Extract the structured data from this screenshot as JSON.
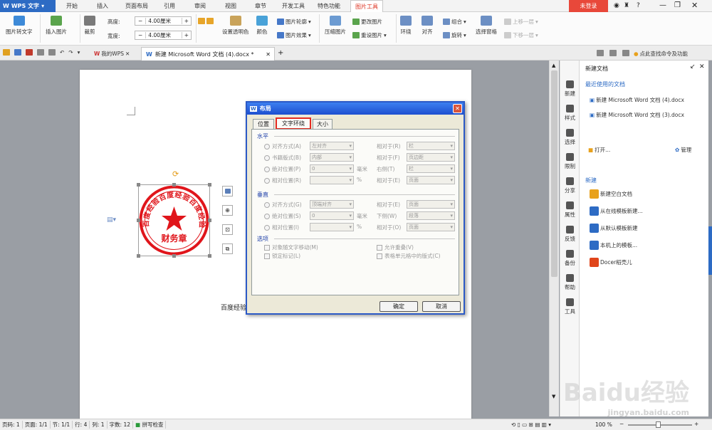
{
  "app": {
    "name": "WPS 文字",
    "login": "未登录",
    "help": "?"
  },
  "tabs": [
    "开始",
    "插入",
    "页面布局",
    "引用",
    "审阅",
    "视图",
    "章节",
    "开发工具",
    "特色功能",
    "图片工具"
  ],
  "ribbon": {
    "pic_to_text": "图片转文字",
    "insert_pic": "插入图片",
    "crop": "裁剪",
    "height_label": "高度:",
    "height_value": "4.00厘米",
    "width_label": "宽度:",
    "width_value": "4.00厘米",
    "set_transparent": "设置透明色",
    "color": "颜色",
    "outline": "图片轮廓",
    "effect": "图片效果",
    "compress": "压缩图片",
    "change_pic": "更改图片",
    "reset_pic": "重设图片",
    "wrap": "环绕",
    "align": "对齐",
    "group": "组合",
    "rotate": "旋转",
    "select_pane": "选择窗格",
    "bring_forward": "上移一层",
    "send_backward": "下移一层"
  },
  "quickaccess": {
    "my_wps": "我的WPS",
    "doc_tab": "新建 Microsoft Word 文档 (4).docx *",
    "search_hint": "点此查找命令及功能"
  },
  "seal": {
    "ring_text": "百度经验百度经验百度经验",
    "center_text": "财务章"
  },
  "page_text": "百度经验",
  "dialog": {
    "title": "布局",
    "tabs": [
      "位置",
      "文字环绕",
      "大小"
    ],
    "active_tab": "文字环绕",
    "horizontal": "水平",
    "vertical": "垂直",
    "options": "选项",
    "h_rows": [
      {
        "label": "对齐方式(A)",
        "value": "左对齐",
        "rel": "相对于(R)",
        "relv": "栏"
      },
      {
        "label": "书籍版式(B)",
        "value": "内部",
        "rel": "相对于(F)",
        "relv": "页边距"
      },
      {
        "label": "绝对位置(P)",
        "value": "0",
        "unit": "毫米",
        "rel": "右侧(T)",
        "relv": "栏"
      },
      {
        "label": "相对位置(R)",
        "value": "",
        "unit": "%",
        "rel": "相对于(E)",
        "relv": "页面"
      }
    ],
    "v_rows": [
      {
        "label": "对齐方式(G)",
        "value": "顶端对齐",
        "rel": "相对于(E)",
        "relv": "页面"
      },
      {
        "label": "绝对位置(S)",
        "value": "0",
        "unit": "毫米",
        "rel": "下侧(W)",
        "relv": "段落"
      },
      {
        "label": "相对位置(I)",
        "value": "",
        "unit": "%",
        "rel": "相对于(O)",
        "relv": "页面"
      }
    ],
    "opt_move": "对象随文字移动(M)",
    "opt_lock": "锁定标记(L)",
    "opt_overlap": "允许重叠(V)",
    "opt_table": "表格单元格中的版式(C)",
    "ok": "确定",
    "cancel": "取消"
  },
  "sidebar": {
    "title": "新建文档",
    "recent_title": "最近使用的文档",
    "recent": [
      "新建 Microsoft Word 文档 (4).docx",
      "新建 Microsoft Word 文档 (3).docx"
    ],
    "open": "打开...",
    "manage": "管理",
    "new_title": "新建",
    "new_items": [
      "新建空白文档",
      "从在线模板新建...",
      "从默认模板新建",
      "本机上的模板...",
      "Docer稻壳儿"
    ]
  },
  "rail": [
    "新建",
    "样式",
    "选择",
    "限制",
    "分享",
    "属性",
    "反馈",
    "备份",
    "帮助",
    "工具"
  ],
  "status": {
    "page": "页码: 1",
    "pages": "页面: 1/1",
    "section": "节: 1/1",
    "row": "行: 4",
    "col": "列: 1",
    "words": "字数: 12",
    "spell": "拼写检查",
    "zoom": "100 %"
  },
  "watermark": "Baidu经验",
  "watermark_sub": "jingyan.baidu.com"
}
